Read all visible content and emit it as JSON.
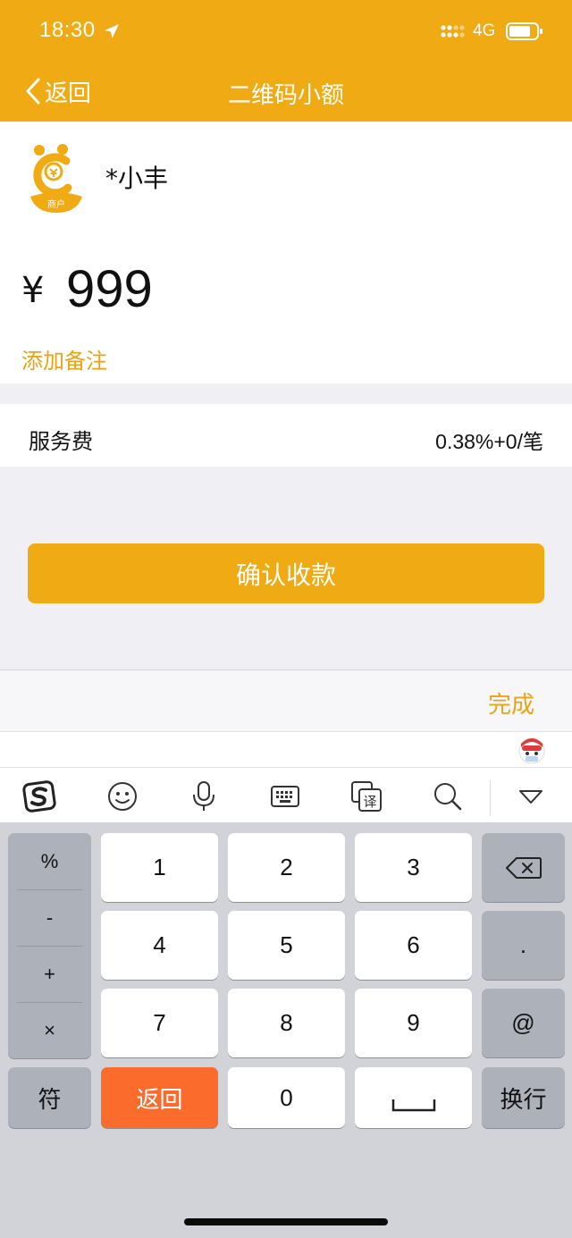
{
  "status_bar": {
    "time": "18:30",
    "network": "4G"
  },
  "nav": {
    "back_label": "返回",
    "title": "二维码小额"
  },
  "merchant": {
    "logo_text": "商户",
    "name": "*小丰"
  },
  "payment": {
    "currency": "¥",
    "amount": "999",
    "add_note_label": "添加备注"
  },
  "fee": {
    "label": "服务费",
    "value": "0.38%+0/笔"
  },
  "confirm_button": "确认收款",
  "keyboard_bar": {
    "done_label": "完成"
  },
  "ime_toolbar": {
    "icons": [
      "sogou-logo-icon",
      "emoji-icon",
      "microphone-icon",
      "keyboard-icon",
      "translate-icon",
      "search-icon",
      "collapse-keyboard-icon"
    ],
    "translate_glyph": "译"
  },
  "keyboard": {
    "symbols": [
      "%",
      "-",
      "+",
      "×"
    ],
    "digits": [
      "1",
      "2",
      "3",
      "4",
      "5",
      "6",
      "7",
      "8",
      "9",
      "0"
    ],
    "dot": ".",
    "at": "@",
    "symbol_key": "符",
    "return_key": "返回",
    "enter_key": "换行"
  },
  "colors": {
    "brand": "#f0ab14",
    "accent_text": "#e8a316",
    "return_key": "#fb6b2b"
  }
}
